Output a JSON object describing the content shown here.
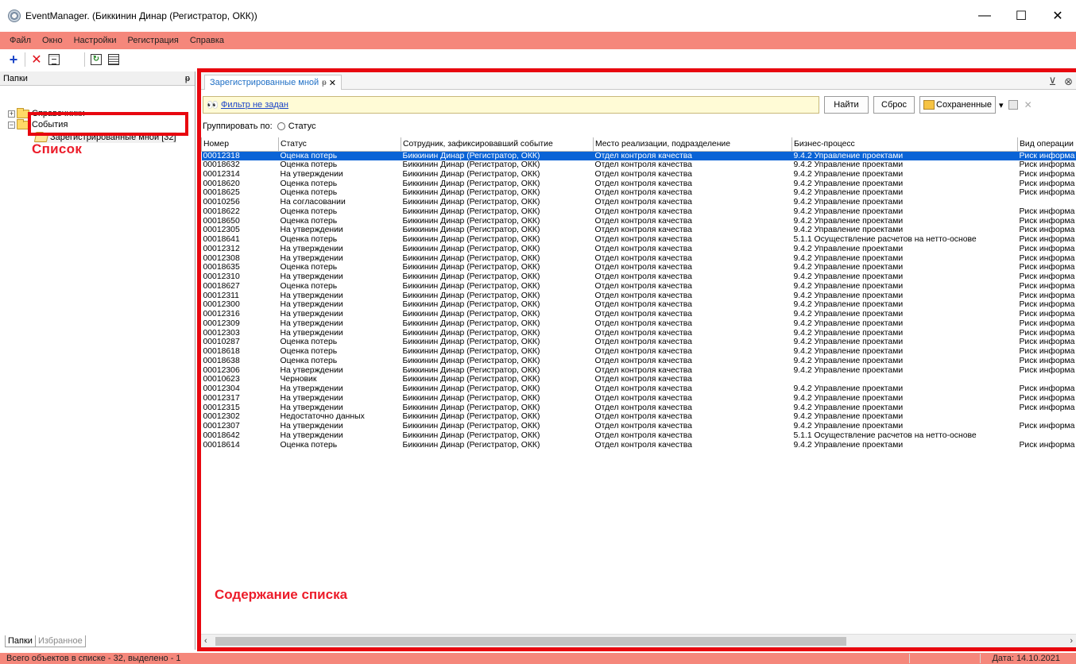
{
  "window": {
    "title": "EventManager. (Биккинин Динар (Регистратор, ОКК))",
    "minimize": "—",
    "maximize": "☐",
    "close": "✕"
  },
  "menu": [
    "Файл",
    "Окно",
    "Настройки",
    "Регистрация",
    "Справка"
  ],
  "toolbar": {
    "add": "+",
    "delete": "✕"
  },
  "left_panel": {
    "header": "Папки",
    "pin": "ᵽ",
    "tree": {
      "item1": "Справочники",
      "item2": "События",
      "item3": "Зарегистрированные мной [32]"
    },
    "annotation": "Список",
    "tabs": {
      "folders": "Папки",
      "favorites": "Избранное"
    }
  },
  "doc_tab": {
    "label": "Зарегистрированные мной",
    "pin": "ᵽ",
    "close": "✕"
  },
  "tabbar_icons": {
    "filter": "⊻",
    "close": "⊗"
  },
  "filter": {
    "icon": "👀",
    "link": "Фильтр не задан",
    "find_button": "Найти",
    "reset_button": "Сброс",
    "saved_button": "Сохраненные",
    "saved_arrow": "▾",
    "clear": "✕"
  },
  "group_by": {
    "label": "Группировать по:",
    "option": "Статус"
  },
  "table": {
    "columns": [
      "Номер",
      "Статус",
      "Сотрудник, зафиксировавший событие",
      "Место реализации, подразделение",
      "Бизнес-процесс",
      "Вид операции"
    ],
    "rows": [
      [
        "00012318",
        "Оценка потерь",
        "Биккинин Динар (Регистратор, ОКК)",
        "Отдел контроля качества",
        "9.4.2 Управление проектами",
        "Риск информа"
      ],
      [
        "00018632",
        "Оценка потерь",
        "Биккинин Динар (Регистратор, ОКК)",
        "Отдел контроля качества",
        "9.4.2 Управление проектами",
        "Риск информа"
      ],
      [
        "00012314",
        "На утверждении",
        "Биккинин Динар (Регистратор, ОКК)",
        "Отдел контроля качества",
        "9.4.2 Управление проектами",
        "Риск информа"
      ],
      [
        "00018620",
        "Оценка потерь",
        "Биккинин Динар (Регистратор, ОКК)",
        "Отдел контроля качества",
        "9.4.2 Управление проектами",
        "Риск информа"
      ],
      [
        "00018625",
        "Оценка потерь",
        "Биккинин Динар (Регистратор, ОКК)",
        "Отдел контроля качества",
        "9.4.2 Управление проектами",
        "Риск информа"
      ],
      [
        "00010256",
        "На согласовании",
        "Биккинин Динар (Регистратор, ОКК)",
        "Отдел контроля качества",
        "9.4.2 Управление проектами",
        ""
      ],
      [
        "00018622",
        "Оценка потерь",
        "Биккинин Динар (Регистратор, ОКК)",
        "Отдел контроля качества",
        "9.4.2 Управление проектами",
        "Риск информа"
      ],
      [
        "00018650",
        "Оценка потерь",
        "Биккинин Динар (Регистратор, ОКК)",
        "Отдел контроля качества",
        "9.4.2 Управление проектами",
        "Риск информа"
      ],
      [
        "00012305",
        "На утверждении",
        "Биккинин Динар (Регистратор, ОКК)",
        "Отдел контроля качества",
        "9.4.2 Управление проектами",
        "Риск информа"
      ],
      [
        "00018641",
        "Оценка потерь",
        "Биккинин Динар (Регистратор, ОКК)",
        "Отдел контроля качества",
        "5.1.1 Осуществление расчетов на нетто-основе",
        "Риск информа"
      ],
      [
        "00012312",
        "На утверждении",
        "Биккинин Динар (Регистратор, ОКК)",
        "Отдел контроля качества",
        "9.4.2 Управление проектами",
        "Риск информа"
      ],
      [
        "00012308",
        "На утверждении",
        "Биккинин Динар (Регистратор, ОКК)",
        "Отдел контроля качества",
        "9.4.2 Управление проектами",
        "Риск информа"
      ],
      [
        "00018635",
        "Оценка потерь",
        "Биккинин Динар (Регистратор, ОКК)",
        "Отдел контроля качества",
        "9.4.2 Управление проектами",
        "Риск информа"
      ],
      [
        "00012310",
        "На утверждении",
        "Биккинин Динар (Регистратор, ОКК)",
        "Отдел контроля качества",
        "9.4.2 Управление проектами",
        "Риск информа"
      ],
      [
        "00018627",
        "Оценка потерь",
        "Биккинин Динар (Регистратор, ОКК)",
        "Отдел контроля качества",
        "9.4.2 Управление проектами",
        "Риск информа"
      ],
      [
        "00012311",
        "На утверждении",
        "Биккинин Динар (Регистратор, ОКК)",
        "Отдел контроля качества",
        "9.4.2 Управление проектами",
        "Риск информа"
      ],
      [
        "00012300",
        "На утверждении",
        "Биккинин Динар (Регистратор, ОКК)",
        "Отдел контроля качества",
        "9.4.2 Управление проектами",
        "Риск информа"
      ],
      [
        "00012316",
        "На утверждении",
        "Биккинин Динар (Регистратор, ОКК)",
        "Отдел контроля качества",
        "9.4.2 Управление проектами",
        "Риск информа"
      ],
      [
        "00012309",
        "На утверждении",
        "Биккинин Динар (Регистратор, ОКК)",
        "Отдел контроля качества",
        "9.4.2 Управление проектами",
        "Риск информа"
      ],
      [
        "00012303",
        "На утверждении",
        "Биккинин Динар (Регистратор, ОКК)",
        "Отдел контроля качества",
        "9.4.2 Управление проектами",
        "Риск информа"
      ],
      [
        "00010287",
        "Оценка потерь",
        "Биккинин Динар (Регистратор, ОКК)",
        "Отдел контроля качества",
        "9.4.2 Управление проектами",
        "Риск информа"
      ],
      [
        "00018618",
        "Оценка потерь",
        "Биккинин Динар (Регистратор, ОКК)",
        "Отдел контроля качества",
        "9.4.2 Управление проектами",
        "Риск информа"
      ],
      [
        "00018638",
        "Оценка потерь",
        "Биккинин Динар (Регистратор, ОКК)",
        "Отдел контроля качества",
        "9.4.2 Управление проектами",
        "Риск информа"
      ],
      [
        "00012306",
        "На утверждении",
        "Биккинин Динар (Регистратор, ОКК)",
        "Отдел контроля качества",
        "9.4.2 Управление проектами",
        "Риск информа"
      ],
      [
        "00010623",
        "Черновик",
        "Биккинин Динар (Регистратор, ОКК)",
        "Отдел контроля качества",
        "",
        ""
      ],
      [
        "00012304",
        "На утверждении",
        "Биккинин Динар (Регистратор, ОКК)",
        "Отдел контроля качества",
        "9.4.2 Управление проектами",
        "Риск информа"
      ],
      [
        "00012317",
        "На утверждении",
        "Биккинин Динар (Регистратор, ОКК)",
        "Отдел контроля качества",
        "9.4.2 Управление проектами",
        "Риск информа"
      ],
      [
        "00012315",
        "На утверждении",
        "Биккинин Динар (Регистратор, ОКК)",
        "Отдел контроля качества",
        "9.4.2 Управление проектами",
        "Риск информа"
      ],
      [
        "00012302",
        "Недостаточно данных",
        "Биккинин Динар (Регистратор, ОКК)",
        "Отдел контроля качества",
        "9.4.2 Управление проектами",
        ""
      ],
      [
        "00012307",
        "На утверждении",
        "Биккинин Динар (Регистратор, ОКК)",
        "Отдел контроля качества",
        "9.4.2 Управление проектами",
        "Риск информа"
      ],
      [
        "00018642",
        "На утверждении",
        "Биккинин Динар (Регистратор, ОКК)",
        "Отдел контроля качества",
        "5.1.1 Осуществление расчетов на нетто-основе",
        ""
      ],
      [
        "00018614",
        "Оценка потерь",
        "Биккинин Динар (Регистратор, ОКК)",
        "Отдел контроля качества",
        "9.4.2 Управление проектами",
        "Риск информа"
      ]
    ]
  },
  "main_annotation": "Содержание списка",
  "hscroll": {
    "left": "‹",
    "right": "›"
  },
  "status": {
    "left": "Всего объектов в списке - 32, выделено - 1",
    "date": "Дата: 14.10.2021"
  }
}
